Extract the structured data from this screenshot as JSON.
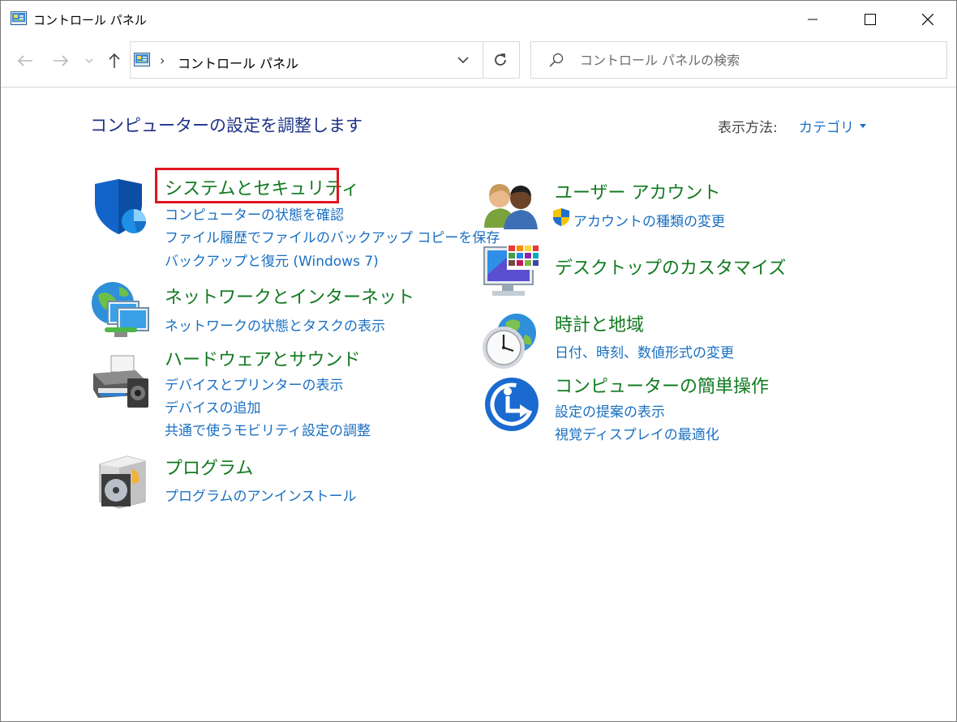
{
  "window": {
    "title": "コントロール パネル",
    "buttons": {
      "minimize": "minimize-icon",
      "maximize": "maximize-icon",
      "close": "close-icon"
    }
  },
  "nav": {
    "address": "コントロール パネル",
    "search_placeholder": "コントロール パネルの検索"
  },
  "content": {
    "heading": "コンピューターの設定を調整します",
    "view_label": "表示方法:",
    "view_value": "カテゴリ"
  },
  "left_categories": [
    {
      "title": "システムとセキュリティ",
      "icon": "shield-icon",
      "links": [
        "コンピューターの状態を確認",
        "ファイル履歴でファイルのバックアップ コピーを保存",
        "バックアップと復元 (Windows 7)"
      ]
    },
    {
      "title": "ネットワークとインターネット",
      "icon": "network-globe-icon",
      "links": [
        "ネットワークの状態とタスクの表示"
      ]
    },
    {
      "title": "ハードウェアとサウンド",
      "icon": "printer-icon",
      "links": [
        "デバイスとプリンターの表示",
        "デバイスの追加",
        "共通で使うモビリティ設定の調整"
      ]
    },
    {
      "title": "プログラム",
      "icon": "programs-disc-icon",
      "links": [
        "プログラムのアンインストール"
      ]
    }
  ],
  "right_categories": [
    {
      "title": "ユーザー アカウント",
      "icon": "users-icon",
      "links": [
        "アカウントの種類の変更"
      ]
    },
    {
      "title": "デスクトップのカスタマイズ",
      "icon": "desktop-monitor-icon",
      "links": []
    },
    {
      "title": "時計と地域",
      "icon": "clock-globe-icon",
      "links": [
        "日付、時刻、数値形式の変更"
      ]
    },
    {
      "title": "コンピューターの簡単操作",
      "icon": "ease-of-access-icon",
      "links": [
        "設定の提案の表示",
        "視覚ディスプレイの最適化"
      ]
    }
  ],
  "colors": {
    "heading": "#1e3287",
    "category": "#117a20",
    "link": "#1a6fc1",
    "highlight": "#e0151f"
  }
}
